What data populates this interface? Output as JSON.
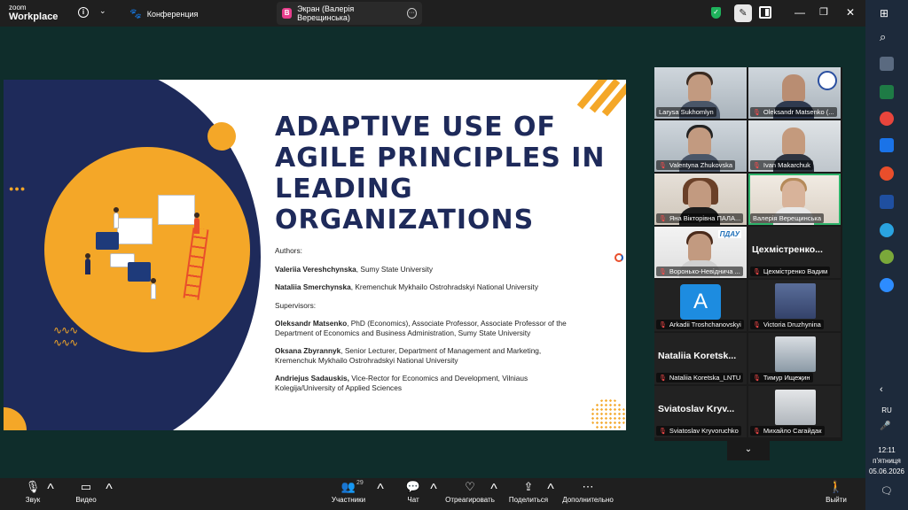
{
  "app": {
    "logo_line1": "zoom",
    "logo_line2": "Workplace",
    "meeting_title": "Конференция",
    "screen_tab_badge": "В",
    "screen_tab_label": "Экран (Валерія Верещинська)"
  },
  "slide": {
    "title": "ADAPTIVE USE OF AGILE PRINCIPLES IN LEADING ORGANIZATIONS",
    "authors_label": "Authors:",
    "author1_name": "Valeriia Vereshchynska",
    "author1_affil": ", Sumy State University",
    "author2_name": "Nataliia Smerchynska",
    "author2_affil": ", Kremenchuk Mykhailo Ostrohradskyi National University",
    "supervisors_label": "Supervisors:",
    "sup1_name": "Oleksandr Matsenko",
    "sup1_desc": ", PhD (Economics), Associate Professor, Associate Professor of the Department of Economics and Business Administration, Sumy State University",
    "sup2_name": "Oksana Zbyrannyk",
    "sup2_desc": ", Senior Lecturer, Department of Management and Marketing, Kremenchuk Mykhailo Ostrohradskyi National University",
    "sup3_name": "Andriejus Sadauskis,",
    "sup3_desc": " Vice-Rector for Economics and Development, Vilniaus Kolegija/University of Applied Sciences"
  },
  "participants": [
    {
      "name": "Larysa Sukhomlyn",
      "muted": false
    },
    {
      "name": "Oleksandr Matsenko (...",
      "muted": true
    },
    {
      "name": "Valentyna Zhukovska",
      "muted": true
    },
    {
      "name": "Ivan Makarchuk",
      "muted": true
    },
    {
      "name": "Яна Вікторівна ПАЛА...",
      "muted": true
    },
    {
      "name": "Валерія Верещинська",
      "muted": false
    },
    {
      "name": "Воронько-Невіднича ...",
      "muted": true,
      "logo_text": "ПДАУ"
    },
    {
      "name": "Цехмістренко Вадим",
      "muted": true,
      "big_name": "Цехмістренко..."
    },
    {
      "name": "Arkadii Troshchanovskyi",
      "muted": true,
      "avatar_letter": "A"
    },
    {
      "name": "Victoria Druzhynina",
      "muted": true
    },
    {
      "name": "Nataliia Koretska_LNTU",
      "muted": true,
      "big_name": "Nataliia Koretsk..."
    },
    {
      "name": "Тимур Ищеҗин",
      "muted": true
    },
    {
      "name": "Sviatoslav Kryvoruchko",
      "muted": true,
      "big_name": "Sviatoslav Kryv..."
    },
    {
      "name": "Михайло Сагайдак",
      "muted": true
    }
  ],
  "toolbar": {
    "audio": "Звук",
    "video": "Видео",
    "participants": "Участники",
    "participants_count": "29",
    "chat": "Чат",
    "react": "Отреагировать",
    "share": "Поделиться",
    "more": "Дополнительно",
    "leave": "Выйти"
  },
  "taskbar": {
    "lang": "RU",
    "time": "12:11",
    "day": "п'ятниця",
    "date": "05.06.2026"
  },
  "colors": {
    "navy": "#1e2a5a",
    "orange": "#f4a728",
    "stage_bg": "#0f2d2b",
    "active_speaker": "#2fb36b"
  }
}
